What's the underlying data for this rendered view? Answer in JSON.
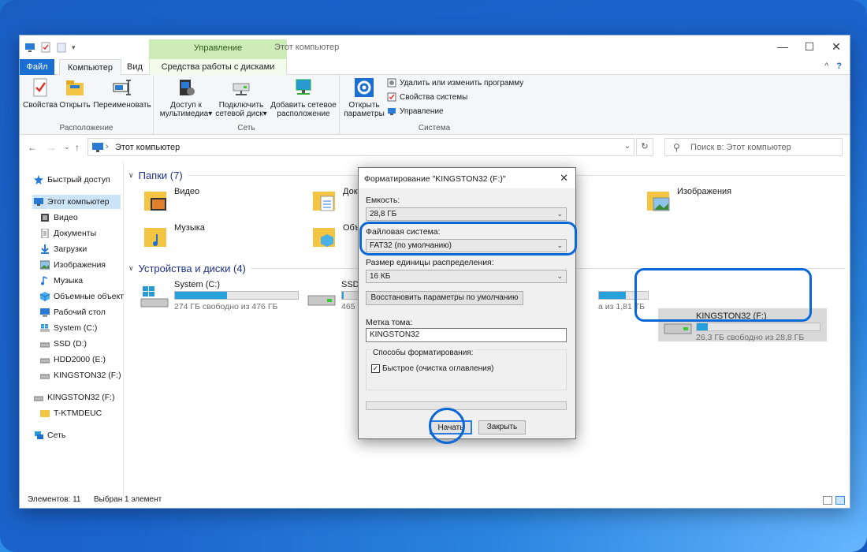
{
  "window": {
    "title": "Этот компьютер",
    "context_tab_header": "Управление",
    "controls": {
      "minimize": "—",
      "maximize": "☐",
      "close": "✕"
    }
  },
  "tabs": {
    "file": "Файл",
    "computer": "Компьютер",
    "view": "Вид",
    "context": "Средства работы с дисками",
    "collapse": "^",
    "help": "?"
  },
  "ribbon": {
    "location_group": {
      "label": "Расположение",
      "properties": "Свойства",
      "open": "Открыть",
      "rename": "Переименовать"
    },
    "network_group": {
      "label": "Сеть",
      "media_line1": "Доступ к",
      "media_line2": "мультимедиа",
      "map_line1": "Подключить",
      "map_line2": "сетевой диск",
      "add_line1": "Добавить сетевое",
      "add_line2": "расположение",
      "dropdown": "▾"
    },
    "system_group": {
      "label": "Система",
      "settings_line1": "Открыть",
      "settings_line2": "параметры",
      "uninstall": "Удалить или изменить программу",
      "sysprops": "Свойства системы",
      "manage": "Управление"
    }
  },
  "address": {
    "back": "←",
    "forward": "→",
    "recent": "⌄",
    "up": "↑",
    "separator": "›",
    "path": "Этот компьютер",
    "dropdown": "⌄",
    "refresh": "↻",
    "search_icon": "⚲",
    "search_placeholder": "Поиск в: Этот компьютер"
  },
  "nav": {
    "quick_access": "Быстрый доступ",
    "this_pc": "Этот компьютер",
    "video": "Видео",
    "documents": "Документы",
    "downloads": "Загрузки",
    "pictures": "Изображения",
    "music": "Музыка",
    "objects3d": "Объемные объекты",
    "desktop": "Рабочий стол",
    "system_c": "System (C:)",
    "ssd_d": "SSD (D:)",
    "hdd_e": "HDD2000 (E:)",
    "kingston_f": "KINGSTON32 (F:)",
    "kingston_f2": "KINGSTON32 (F:)",
    "tktm": "T-KTMDEUC",
    "network": "Сеть"
  },
  "content": {
    "folders_header": "Папки (7)",
    "devices_header": "Устройства и диски (4)",
    "folders": {
      "video": "Видео",
      "docs": "Доку",
      "pictures": "Изображения",
      "music": "Музыка",
      "objects": "Объ"
    },
    "drives": {
      "c_name": "System (C:)",
      "c_free": "274 ГБ свободно из 476 ГБ",
      "d_name": "SSD (D:)",
      "d_free": "465",
      "e_free": "а из 1,81 ТБ",
      "f_name": "KINGSTON32 (F:)",
      "f_free": "26,3 ГБ свободно из 28,8 ГБ"
    },
    "drive_usage": {
      "c": 0.42,
      "d": 0.05,
      "e": 0.55,
      "f": 0.09
    }
  },
  "status": {
    "items": "Элементов: 11",
    "selected": "Выбран 1 элемент"
  },
  "dialog": {
    "title": "Форматирование \"KINGSTON32 (F:)\"",
    "close": "✕",
    "capacity_label": "Емкость:",
    "capacity_value": "28,8 ГБ",
    "fs_label": "Файловая система:",
    "fs_value": "FAT32 (по умолчанию)",
    "cluster_label": "Размер единицы распределения:",
    "cluster_value": "16 КБ",
    "restore_button": "Восстановить параметры по умолчанию",
    "volume_label": "Метка тома:",
    "volume_value": "KINGSTON32",
    "options_legend": "Способы форматирования:",
    "quick_check": "✓",
    "quick_label": "Быстрое (очистка оглавления)",
    "start_button": "Начать",
    "close_button": "Закрыть",
    "arrow": "⌄"
  },
  "colors": {
    "accent": "#1a6fd1",
    "highlight_ring": "#0a67d6",
    "drive_bar": "#26a0da",
    "context_tab": "#cdebb7"
  }
}
